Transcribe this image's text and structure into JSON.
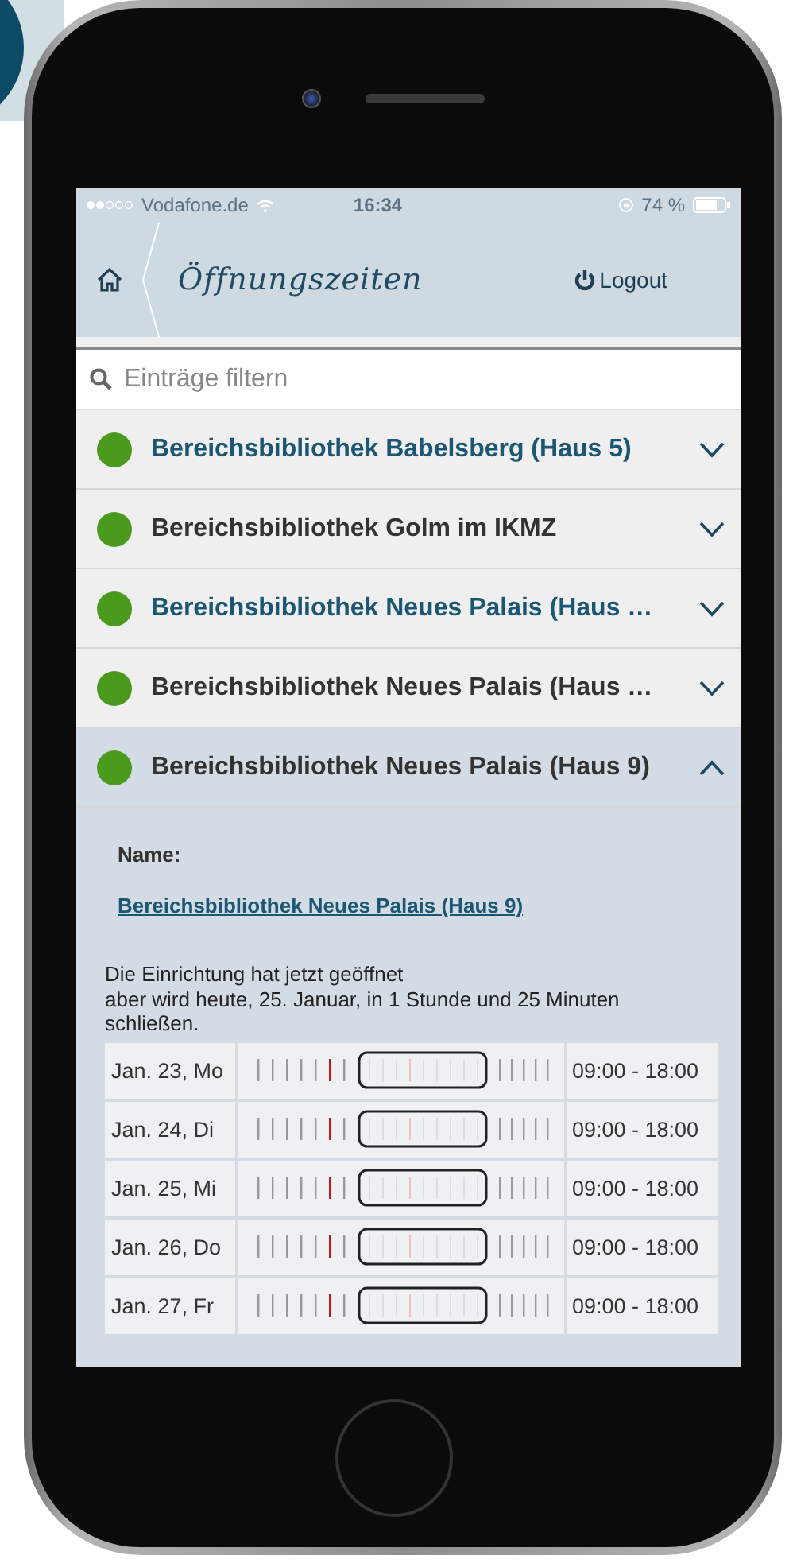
{
  "status_bar": {
    "carrier": "Vodafone.de",
    "time": "16:34",
    "battery": "74 %"
  },
  "nav": {
    "title": "Öffnungszeiten",
    "logout": "Logout"
  },
  "search": {
    "placeholder": "Einträge filtern"
  },
  "libraries": [
    {
      "name": "Bereichsbibliothek Babelsberg (Haus 5)",
      "open": true,
      "highlighted": true,
      "expanded": false
    },
    {
      "name": "Bereichsbibliothek Golm im IKMZ",
      "open": true,
      "highlighted": false,
      "expanded": false
    },
    {
      "name": "Bereichsbibliothek Neues Palais (Haus …",
      "open": true,
      "highlighted": true,
      "expanded": false
    },
    {
      "name": "Bereichsbibliothek Neues Palais (Haus …",
      "open": true,
      "highlighted": false,
      "expanded": false
    },
    {
      "name": "Bereichsbibliothek Neues Palais (Haus 9)",
      "open": true,
      "highlighted": false,
      "expanded": true
    }
  ],
  "details": {
    "name_label": "Name:",
    "name_link": "Bereichsbibliothek Neues Palais (Haus 9)",
    "status_text": "Die Einrichtung hat jetzt geöffnet\naber wird heute, 25. Januar, in 1 Stunde und 25 Minuten schließen.",
    "days": [
      {
        "date": "Jan. 23, Mo",
        "hours": "09:00 - 18:00"
      },
      {
        "date": "Jan. 24, Di",
        "hours": "09:00 - 18:00"
      },
      {
        "date": "Jan. 25, Mi",
        "hours": "09:00 - 18:00"
      },
      {
        "date": "Jan. 26, Do",
        "hours": "09:00 - 18:00"
      },
      {
        "date": "Jan. 27, Fr",
        "hours": "09:00 - 18:00"
      }
    ]
  }
}
